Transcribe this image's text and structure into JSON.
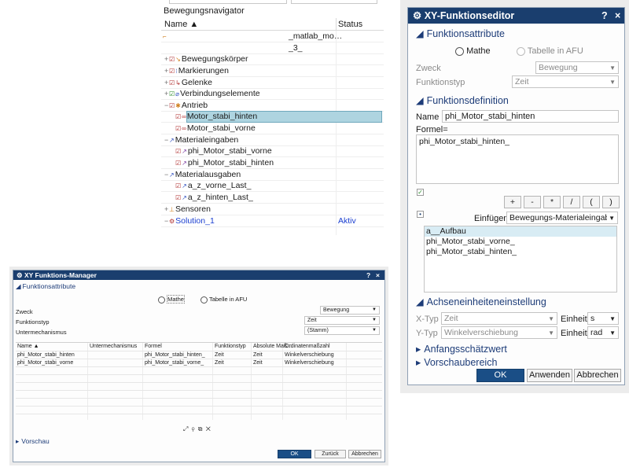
{
  "navigator": {
    "title": "Bewegungsnavigator",
    "col_name": "Name",
    "col_status": "Status",
    "rows": [
      {
        "label": "_matlab_mo…",
        "status": ""
      },
      {
        "label": "_3_",
        "status": ""
      },
      {
        "label": "Bewegungskörper",
        "status": ""
      },
      {
        "label": "Markierungen",
        "status": ""
      },
      {
        "label": "Gelenke",
        "status": ""
      },
      {
        "label": "Verbindungselemente",
        "status": ""
      },
      {
        "label": "Antrieb",
        "status": ""
      },
      {
        "label": "Motor_stabi_hinten",
        "status": ""
      },
      {
        "label": "Motor_stabi_vorne",
        "status": ""
      },
      {
        "label": "Materialeingaben",
        "status": ""
      },
      {
        "label": "phi_Motor_stabi_vorne",
        "status": ""
      },
      {
        "label": "phi_Motor_stabi_hinten",
        "status": ""
      },
      {
        "label": "Materialausgaben",
        "status": ""
      },
      {
        "label": "a_z_vorne_Last_",
        "status": ""
      },
      {
        "label": "a_z_hinten_Last_",
        "status": ""
      },
      {
        "label": "Sensoren",
        "status": ""
      },
      {
        "label": "Solution_1",
        "status": "Aktiv"
      }
    ]
  },
  "editor": {
    "title": "XY-Funktionseditor",
    "help": "?",
    "close": "×",
    "sec_attr": "Funktionsattribute",
    "radio_mathe": "Mathe",
    "radio_afu": "Tabelle in AFU",
    "zweck_label": "Zweck",
    "zweck_value": "Bewegung",
    "typ_label": "Funktionstyp",
    "typ_value": "Zeit",
    "sec_def": "Funktionsdefinition",
    "name_label": "Name",
    "name_value": "phi_Motor_stabi_hinten",
    "formel_label": "Formel=",
    "formel_value": "phi_Motor_stabi_hinten_",
    "ops": [
      "+",
      "-",
      "*",
      "/",
      "(",
      ")"
    ],
    "einfuegen_label": "Einfügen",
    "einfuegen_value": "Bewegungs-Materialeingabe",
    "list_items": [
      "a__Aufbau",
      "phi_Motor_stabi_vorne_",
      "phi_Motor_stabi_hinten_"
    ],
    "sec_axis": "Achseneinheiteneinstellung",
    "xtyp_label": "X-Typ",
    "xtyp_value": "Zeit",
    "ytyp_label": "Y-Typ",
    "ytyp_value": "Winkelverschiebung",
    "einheit_label": "Einheit",
    "x_unit": "s",
    "y_unit": "rad",
    "sec_guess": "Anfangsschätzwert",
    "sec_preview": "Vorschaubereich",
    "btn_ok": "OK",
    "btn_apply": "Anwenden",
    "btn_cancel": "Abbrechen"
  },
  "manager": {
    "title": "XY Funktions-Manager",
    "help": "?",
    "close": "×",
    "sec_attr": "Funktionsattribute",
    "radio_mathe": "Mathe",
    "radio_afu": "Tabelle in AFU",
    "zweck_label": "Zweck",
    "zweck_value": "Bewegung",
    "typ_label": "Funktionstyp",
    "typ_value": "Zeit",
    "unter_label": "Untermechanismus",
    "unter_value": "(Stamm)",
    "columns": [
      "Name",
      "Untermechanismus",
      "Formel",
      "Funktionstyp",
      "Absolute Maß…",
      "Ordinatenmaßzahl"
    ],
    "rows": [
      [
        "phi_Motor_stabi_hinten",
        "",
        "phi_Motor_stabi_hinten_",
        "Zeit",
        "Zeit",
        "Winkelverschiebung"
      ],
      [
        "phi_Motor_stabi_vorne",
        "",
        "phi_Motor_stabi_vorne_",
        "Zeit",
        "Zeit",
        "Winkelverschiebung"
      ]
    ],
    "tools": "⤢ ⚲ ⧉ ✕",
    "sec_preview": "Vorschau",
    "btn_ok": "OK",
    "btn_back": "Zurück",
    "btn_cancel": "Abbrechen"
  }
}
